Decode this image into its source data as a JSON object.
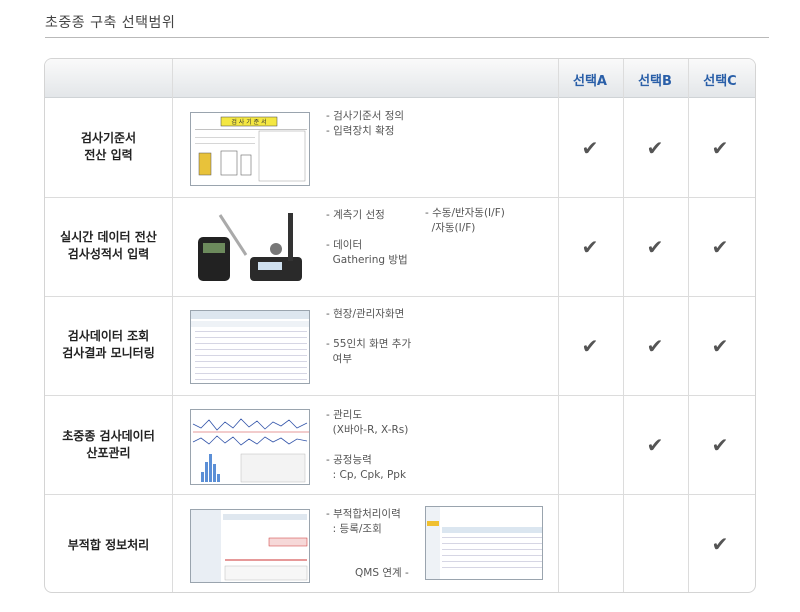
{
  "page_title": "초중종 구축 선택범위",
  "columns": [
    "선택A",
    "선택B",
    "선택C"
  ],
  "rows": [
    {
      "category_lines": [
        "검사기준서",
        "전산 입력"
      ],
      "desc": "- 검사기준서 정의\n- 입력장치 확정",
      "desc2": "",
      "footnote": "",
      "checks": [
        true,
        true,
        true
      ]
    },
    {
      "category_lines": [
        "실시간 데이터 전산",
        "검사성적서 입력"
      ],
      "desc": "- 계측기 선정\n\n- 데이터\n  Gathering 방법",
      "desc2": "- 수동/반자동(I/F)\n  /자동(I/F)",
      "footnote": "",
      "checks": [
        true,
        true,
        true
      ]
    },
    {
      "category_lines": [
        "검사데이터 조회",
        "검사결과 모니터링"
      ],
      "desc": "- 현장/관리자화면\n\n- 55인치 화면 추가\n  여부",
      "desc2": "",
      "footnote": "",
      "checks": [
        true,
        true,
        true
      ]
    },
    {
      "category_lines": [
        "초중종 검사데이터",
        "산포관리"
      ],
      "desc": "- 관리도\n  (X바아-R, X-Rs)\n\n- 공정능력\n  : Cp, Cpk, Ppk",
      "desc2": "",
      "footnote": "",
      "checks": [
        false,
        true,
        true
      ]
    },
    {
      "category_lines": [
        "부적합 정보처리"
      ],
      "desc": "- 부적합처리이력\n  : 등록/조회",
      "desc2": "",
      "footnote": "QMS 연계 -",
      "checks": [
        false,
        false,
        true
      ]
    }
  ],
  "thumb_texts": {
    "inspection_doc_title": "검 사 기 준 서"
  },
  "check_icon": "check-icon",
  "colors": {
    "header_text": "#2a5fa8",
    "check": "#555555"
  }
}
